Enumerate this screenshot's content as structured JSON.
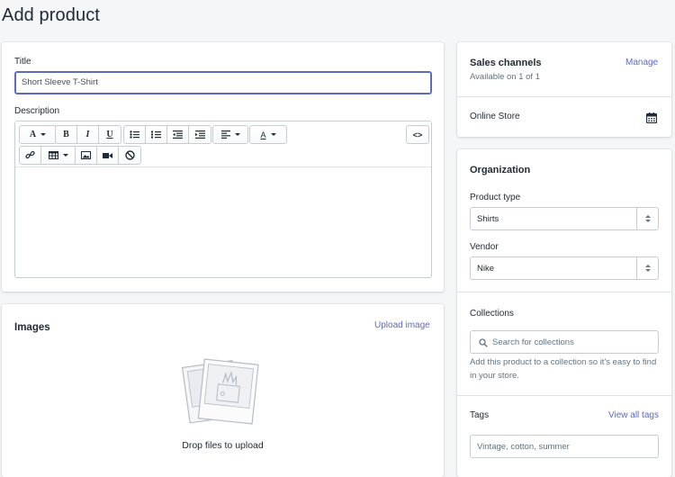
{
  "page": {
    "title": "Add product"
  },
  "product": {
    "title_label": "Title",
    "title_value": "Short Sleeve T-Shirt",
    "description_label": "Description",
    "toolbar": {
      "font_label": "A",
      "bold_label": "B",
      "italic_label": "I",
      "underline_label": "U",
      "color_label": "A",
      "html_label": "<>"
    }
  },
  "images": {
    "heading": "Images",
    "upload_link": "Upload image",
    "drop_text": "Drop files to upload"
  },
  "sales_channels": {
    "heading": "Sales channels",
    "manage_link": "Manage",
    "available_text": "Available on 1 of 1",
    "online_store_label": "Online Store"
  },
  "organization": {
    "heading": "Organization",
    "product_type_label": "Product type",
    "product_type_value": "Shirts",
    "vendor_label": "Vendor",
    "vendor_value": "Nike",
    "collections_label": "Collections",
    "collections_placeholder": "Search for collections",
    "collections_help": "Add this product to a collection so it's easy to find in your store.",
    "tags_label": "Tags",
    "view_all_tags_link": "View all tags",
    "tags_placeholder": "Vintage, cotton, summer"
  },
  "colors": {
    "accent": "#5c6ac4",
    "text": "#212b36",
    "subdued": "#637381",
    "border": "#c4cdd5",
    "background": "#f4f6f8"
  }
}
